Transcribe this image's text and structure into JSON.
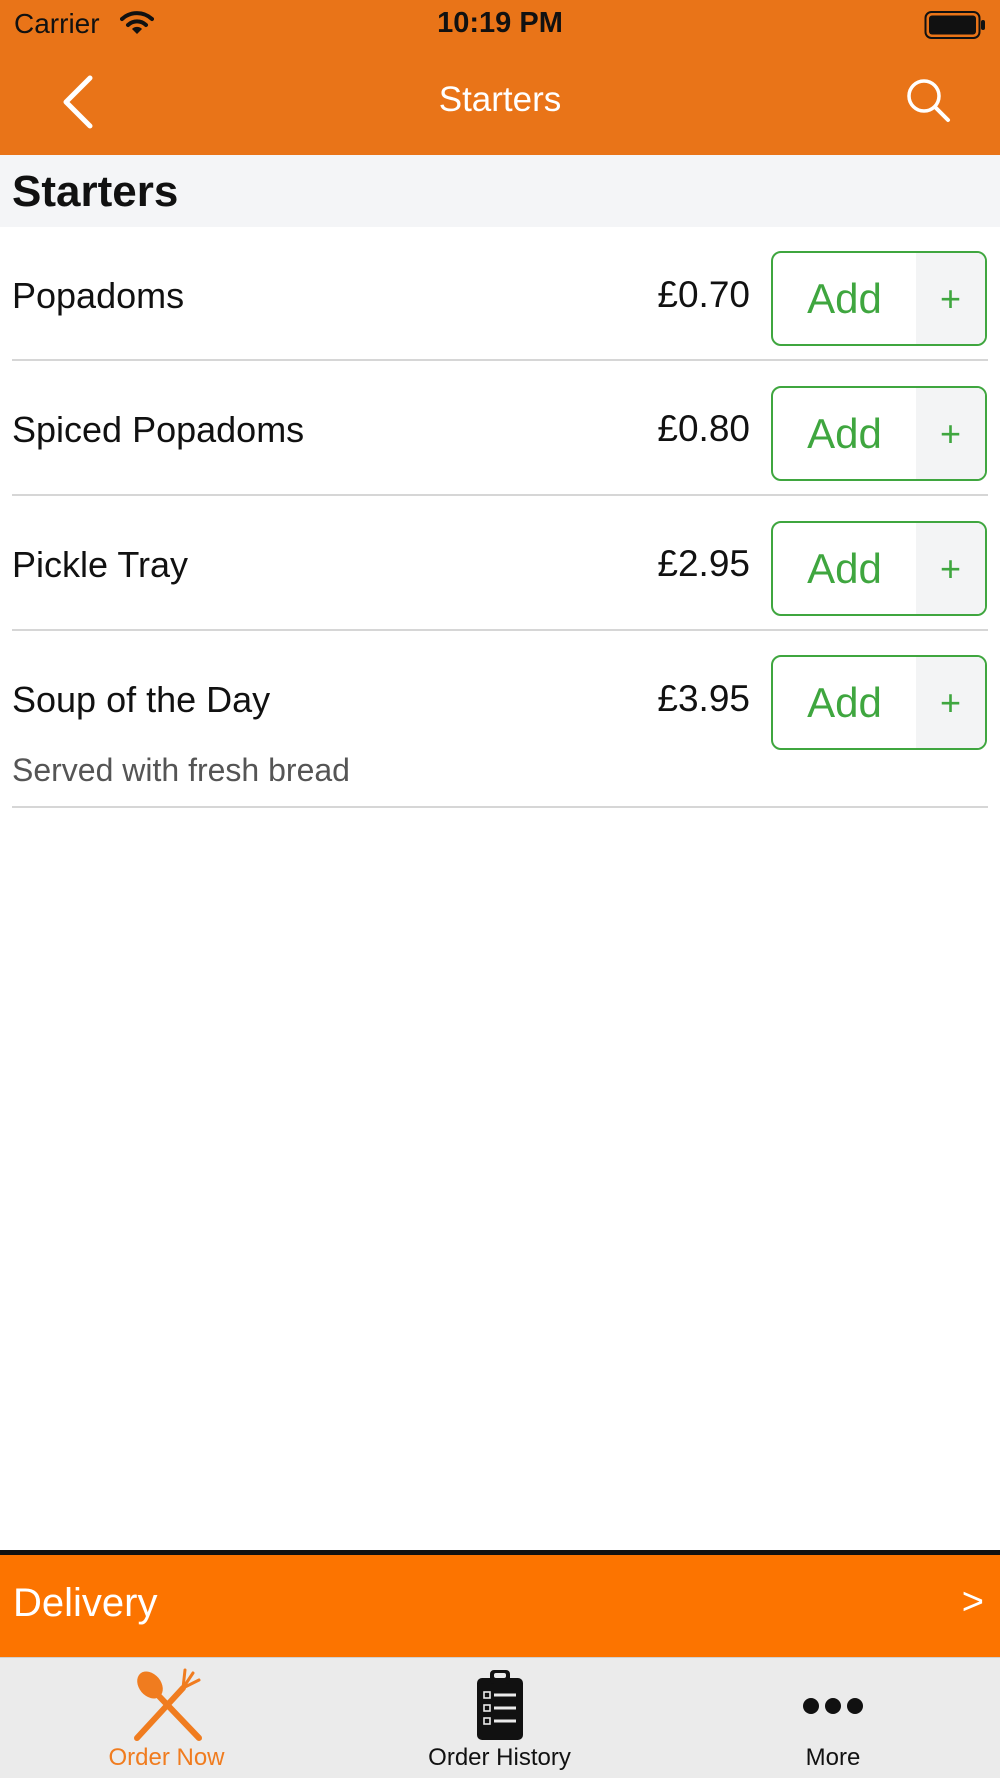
{
  "status_bar": {
    "carrier": "Carrier",
    "time": "10:19 PM"
  },
  "nav": {
    "title": "Starters",
    "back_icon": "chevron-left-icon",
    "search_icon": "search-icon"
  },
  "section": {
    "title": "Starters"
  },
  "items": [
    {
      "name": "Popadoms",
      "price": "£0.70",
      "add_label": "Add",
      "plus_label": "+",
      "description": ""
    },
    {
      "name": "Spiced Popadoms",
      "price": "£0.80",
      "add_label": "Add",
      "plus_label": "+",
      "description": ""
    },
    {
      "name": "Pickle Tray",
      "price": "£2.95",
      "add_label": "Add",
      "plus_label": "+",
      "description": ""
    },
    {
      "name": "Soup of the Day",
      "price": "£3.95",
      "add_label": "Add",
      "plus_label": "+",
      "description": "Served with fresh bread"
    }
  ],
  "delivery_bar": {
    "label": "Delivery",
    "chevron": ">"
  },
  "tabs": [
    {
      "label": "Order Now",
      "icon": "fork-spoon-icon",
      "active": true
    },
    {
      "label": "Order History",
      "icon": "clipboard-list-icon",
      "active": false
    },
    {
      "label": "More",
      "icon": "more-dots-icon",
      "active": false
    }
  ],
  "colors": {
    "header": "#e97418",
    "delivery": "#fc7400",
    "add_green": "#3fa63f",
    "active_tab": "#f07c1f"
  }
}
